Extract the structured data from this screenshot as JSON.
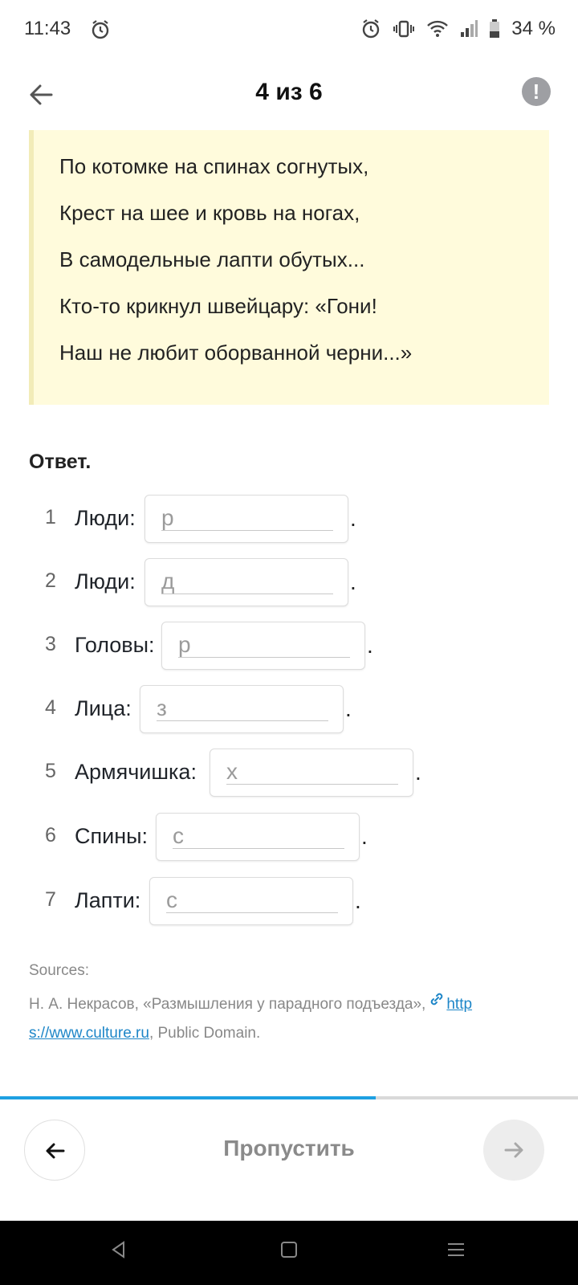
{
  "status_bar": {
    "time": "11:43",
    "battery_text": "34 %"
  },
  "header": {
    "title": "4 из 6",
    "report_glyph": "!"
  },
  "poem": {
    "lines": [
      "По котомке на спинах согнутых,",
      "Крест на шее и кровь на ногах,",
      "В самодельные лапти обутых...",
      "Кто-то крикнул швейцару: «Гони!",
      "Наш не любит оборванной черни...»"
    ]
  },
  "answer": {
    "label": "Ответ.",
    "rows": [
      {
        "num": "1",
        "label": "Люди:",
        "placeholder": "р",
        "dot": "."
      },
      {
        "num": "2",
        "label": "Люди:",
        "placeholder": "д",
        "dot": "."
      },
      {
        "num": "3",
        "label": "Головы:",
        "placeholder": "р",
        "dot": "."
      },
      {
        "num": "4",
        "label": "Лица:",
        "placeholder": "з",
        "dot": "."
      },
      {
        "num": "5",
        "label": "Армячишка:",
        "placeholder": "х",
        "dot": "."
      },
      {
        "num": "6",
        "label": "Спины:",
        "placeholder": "с",
        "dot": "."
      },
      {
        "num": "7",
        "label": "Лапти:",
        "placeholder": "с",
        "dot": "."
      }
    ]
  },
  "sources": {
    "label": "Sources:",
    "prefix": "Н. А. Некрасов, «Размышления у парадного подъезда»,",
    "link_part1": "http",
    "link_part2": "s://www.culture.ru",
    "suffix": ", Public Domain."
  },
  "progress": {
    "fraction": 0.65
  },
  "footer": {
    "skip_label": "Пропустить"
  },
  "colors": {
    "accent": "#1ea0e2",
    "poem_bg": "#fffbdc"
  },
  "icons": [
    "alarm-icon",
    "vibrate-icon",
    "wifi-icon",
    "signal-icon",
    "battery-icon",
    "back-arrow-icon",
    "report-icon",
    "link-icon",
    "prev-arrow-icon",
    "next-arrow-icon",
    "android-back-icon",
    "android-home-icon",
    "android-recents-icon"
  ]
}
